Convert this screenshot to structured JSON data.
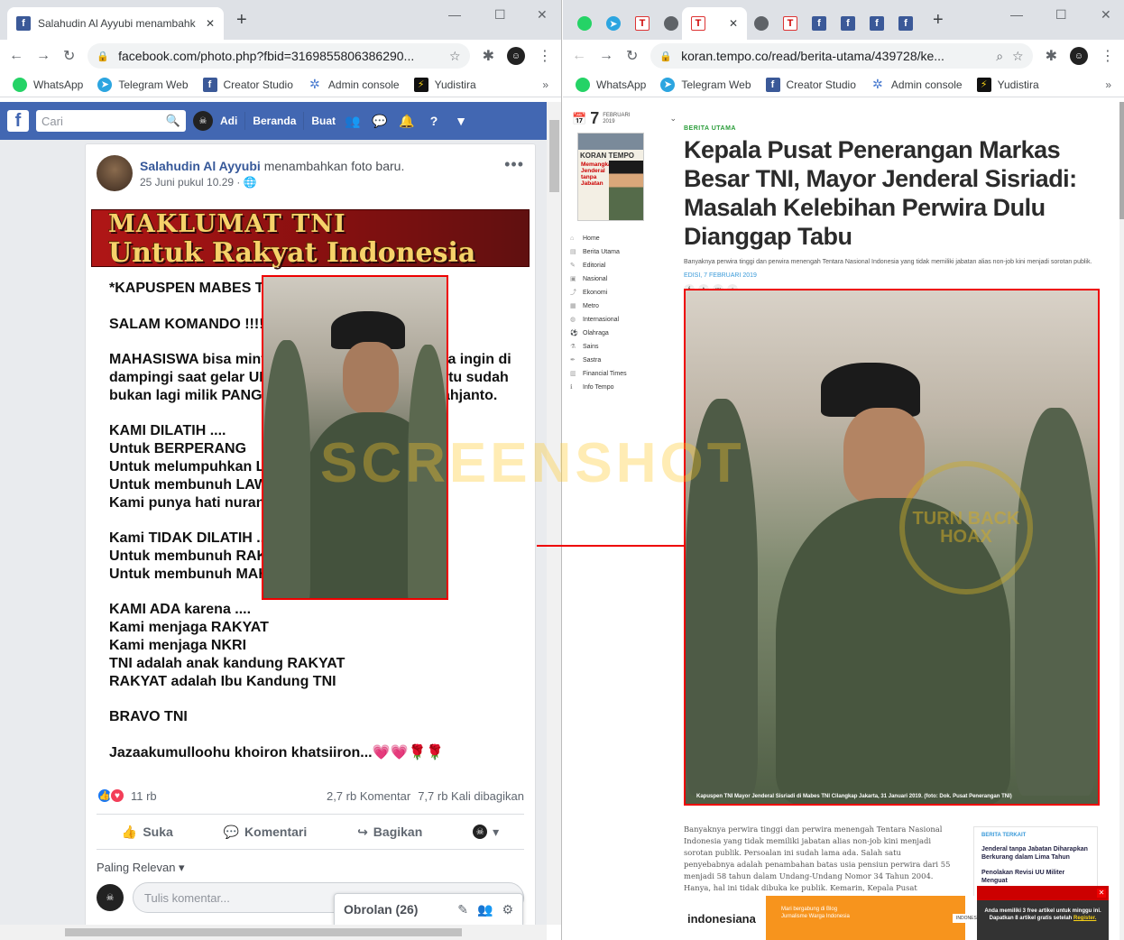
{
  "left": {
    "tab_title": "Salahudin Al Ayyubi menambahkan",
    "url": "facebook.com/photo.php?fbid=3169855806386290...",
    "bookmarks": [
      "WhatsApp",
      "Telegram Web",
      "Creator Studio",
      "Admin console",
      "Yudistira"
    ],
    "fbnav": {
      "search_placeholder": "Cari",
      "user": "Adi",
      "home": "Beranda",
      "create": "Buat"
    },
    "post": {
      "author": "Salahudin Al Ayyubi",
      "action": "menambahkan foto baru.",
      "date": "25 Juni pukul 10.29 ·",
      "banner_line1": "MAKLUMAT TNI",
      "banner_line2": "Untuk Rakyat Indonesia",
      "lines": [
        "*KAPUSPEN MABES TNI MAYJEN SISRIADI*",
        "",
        " SALAM KOMANDO !!!!!",
        "",
        "MAHASISWA bisa minta BANTUAN ke KODAM jika ingin di",
        "dampingi saat gelar UNJUK RASA. Kewenangan itu  sudah",
        "bukan lagi milik PANGLIMA TNI Marsekal Hadi Tjahjanto.",
        "",
        "KAMI DILATIH ....",
        "Untuk  BERPERANG",
        "Untuk melumpuhkan  LAWAN",
        "Untuk membunuh LAWAN tapi",
        "Kami punya hati nurani",
        "",
        "Kami TIDAK DILATIH .....",
        "Untuk membunuh RAKYAT",
        "Untuk membunuh  MAHASISWA",
        "",
        "KAMI ADA karena ....",
        "Kami menjaga RAKYAT",
        "Kami menjaga NKRI",
        "TNI adalah anak kandung RAKYAT",
        "RAKYAT adalah Ibu Kandung TNI",
        "",
        "BRAVO TNI",
        "",
        "Jazaakumulloohu khoiron khatsiiron...💗💗🌹🌹"
      ],
      "reactions_count": "11 rb",
      "comments": "2,7 rb Komentar",
      "shares": "7,7 rb Kali dibagikan",
      "like": "Suka",
      "comment": "Komentari",
      "share": "Bagikan",
      "sort": "Paling Relevan ▾",
      "comment_placeholder": "Tulis komentar..."
    },
    "chat": "Obrolan (26)"
  },
  "watermark": "SCREENSHOT",
  "right": {
    "url": "koran.tempo.co/read/berita-utama/439728/ke...",
    "bookmarks": [
      "WhatsApp",
      "Telegram Web",
      "Creator Studio",
      "Admin console",
      "Yudistira"
    ],
    "date_num": "7",
    "date_mon": "FEBRUARI",
    "date_year": "2019",
    "cover_title": "KORAN TEMPO",
    "cover_headline": "Memangkas Jenderal tanpa Jabatan",
    "menu": [
      "Home",
      "Berita Utama",
      "Editorial",
      "Nasional",
      "Ekonomi",
      "Metro",
      "Internasional",
      "Olahraga",
      "Sains",
      "Sastra",
      "Financial Times",
      "Info Tempo"
    ],
    "kicker": "BERITA UTAMA",
    "headline": "Kepala Pusat Penerangan Markas Besar TNI, Mayor Jenderal Sisriadi: Masalah Kelebihan Perwira Dulu Dianggap Tabu",
    "lead": "Banyaknya perwira tinggi dan perwira menengah Tentara Nasional Indonesia yang tidak memiliki jabatan alias non-job kini menjadi sorotan publik.",
    "edisi": "EDISI, 7 FEBRUARI 2019",
    "caption": "Kapuspen TNI Mayor Jenderal Sisriadi di Mabes TNI Cilangkap Jakarta, 31 Januari 2019. (foto: Dok. Pusat Penerangan TNI)",
    "seal_text": "TURN BACK HOAX",
    "body": "Banyaknya perwira tinggi dan perwira menengah Tentara Nasional Indonesia yang tidak memiliki jabatan alias non-job kini menjadi sorotan publik. Persoalan ini sudah lama ada. Salah satu penyebabnya adalah penambahan batas usia pensiun perwira dari 55 menjadi 58 tahun dalam Undang-Undang Nomor 34 Tahun 2004. Hanya, hal ini tidak dibuka ke publik. Kemarin, Kepala Pusat",
    "related_head": "BERITA TERKAIT",
    "related": [
      "Jenderal tanpa Jabatan Diharapkan Berkurang dalam Lima Tahun",
      "Penolakan Revisi UU Militer Menguat"
    ],
    "ad_brand": "indonesiana",
    "ad_msg": "Mari bergabung di Blog Jurnalisme Warga Indonesia",
    "ad_tag": "INDONESIANA.ID",
    "promo": "Anda memiliki 3 free artikel untuk minggu ini. Dapatkan 8 artikel gratis setelah",
    "promo_link": "Register."
  }
}
